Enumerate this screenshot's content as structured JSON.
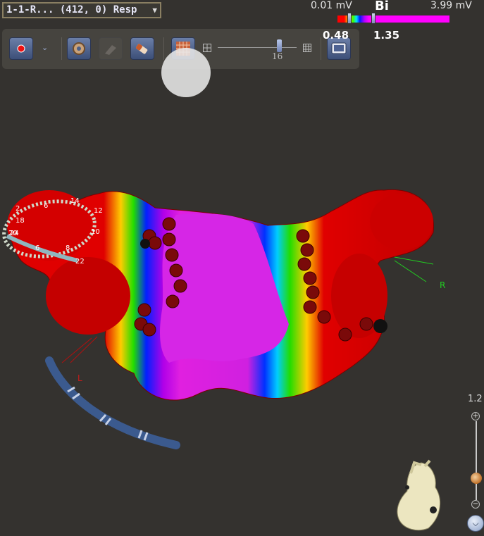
{
  "map_selector": {
    "value": "1-1-R... (412, 0) Resp",
    "chevron_icon": "chevron-down-icon"
  },
  "toolbar": {
    "record_icon": "record-icon",
    "dropdown_icon": "chevron-down-icon",
    "tool1_icon": "catheter-settings-icon",
    "tool2_icon": "erase-icon",
    "tool3_icon": "paint-icon",
    "grid_icon": "mesh-grid-icon",
    "slider_value": "16",
    "slider_level": 0.78,
    "monitor_icon": "monitor-icon"
  },
  "color_scale": {
    "min": "0.01 mV",
    "max": "3.99 mV",
    "mode": "Bi",
    "low_marker": "0.48",
    "high_marker": "1.35",
    "colors": [
      "#ff0000",
      "#ffd400",
      "#3cff00",
      "#00e0ff",
      "#0018ff",
      "#b000ff",
      "#ff00ff"
    ]
  },
  "map": {
    "label_left": "L",
    "label_right": "R",
    "electrode_labels": [
      "2",
      "6",
      "14",
      "12",
      "18",
      "20",
      "24",
      "10",
      "6",
      "8",
      "22"
    ]
  },
  "zoom": {
    "value": "1.2",
    "plus": "+",
    "minus": "−",
    "expand_icon": "chevron-down-icon"
  },
  "orientation_icon": "heart-orientation-icon"
}
